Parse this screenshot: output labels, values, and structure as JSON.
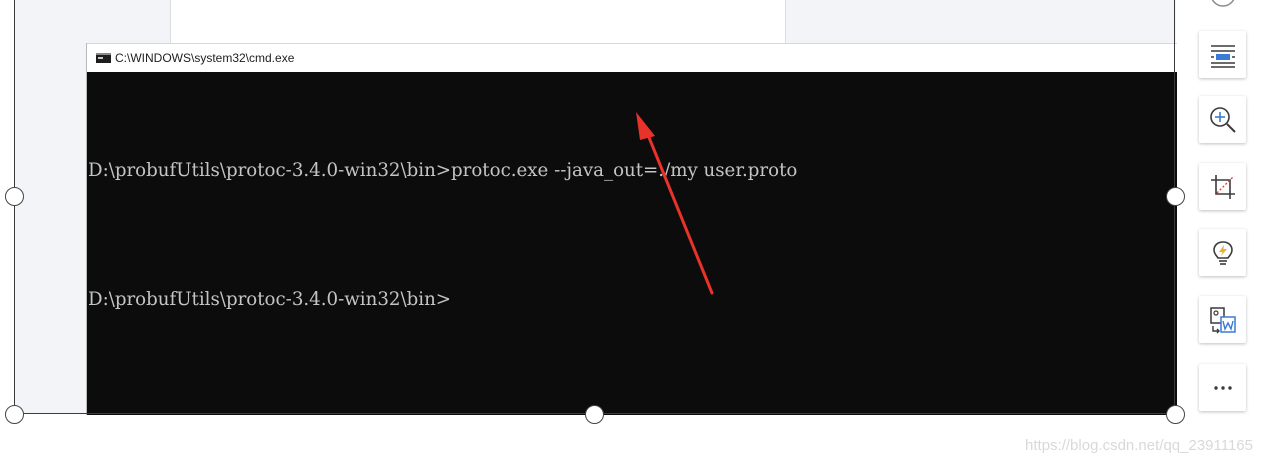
{
  "cmd_window": {
    "title": "C:\\WINDOWS\\system32\\cmd.exe",
    "lines": [
      "D:\\probufUtils\\protoc-3.4.0-win32\\bin>protoc.exe --java_out=./my user.proto",
      "D:\\probufUtils\\protoc-3.4.0-win32\\bin>"
    ]
  },
  "toolbar": {
    "buttons": [
      {
        "name": "minus-circle-icon"
      },
      {
        "name": "text-wrap-icon"
      },
      {
        "name": "zoom-in-icon"
      },
      {
        "name": "crop-icon"
      },
      {
        "name": "lightbulb-icon"
      },
      {
        "name": "convert-to-word-icon"
      },
      {
        "name": "more-icon"
      }
    ]
  },
  "watermark": "https://blog.csdn.net/qq_23911165",
  "colors": {
    "console_bg": "#0c0c0c",
    "console_text": "#c4c4c4",
    "annotation_arrow": "#e8322a",
    "toolbar_icon": "#3a3a3a",
    "toolbar_accent": "#3a7bd5"
  }
}
